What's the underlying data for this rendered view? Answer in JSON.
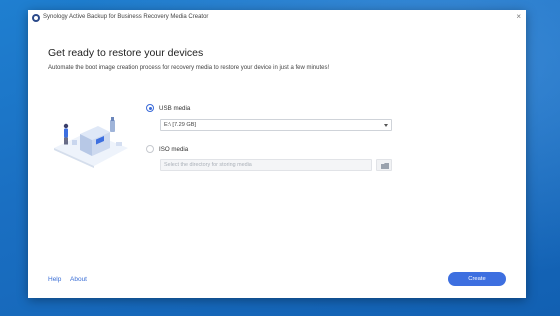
{
  "window": {
    "title": "Synology Active Backup for Business Recovery Media Creator",
    "close_glyph": "×"
  },
  "content": {
    "heading": "Get ready to restore your devices",
    "subheading": "Automate the boot image creation process for recovery media to restore your device in just a few minutes!"
  },
  "options": {
    "usb": {
      "label": "USB media",
      "selected": true,
      "drive_value": "E:\\ [7.29 GB]"
    },
    "iso": {
      "label": "ISO media",
      "selected": false,
      "directory_placeholder": "Select the directory for storing media"
    }
  },
  "footer": {
    "help_label": "Help",
    "about_label": "About",
    "create_label": "Create"
  },
  "colors": {
    "accent": "#3d6fe0",
    "desktop": "#1a6fc2"
  },
  "icons": {
    "app": "synology-icon",
    "folder": "folder-icon",
    "dropdown": "chevron-down-icon"
  }
}
